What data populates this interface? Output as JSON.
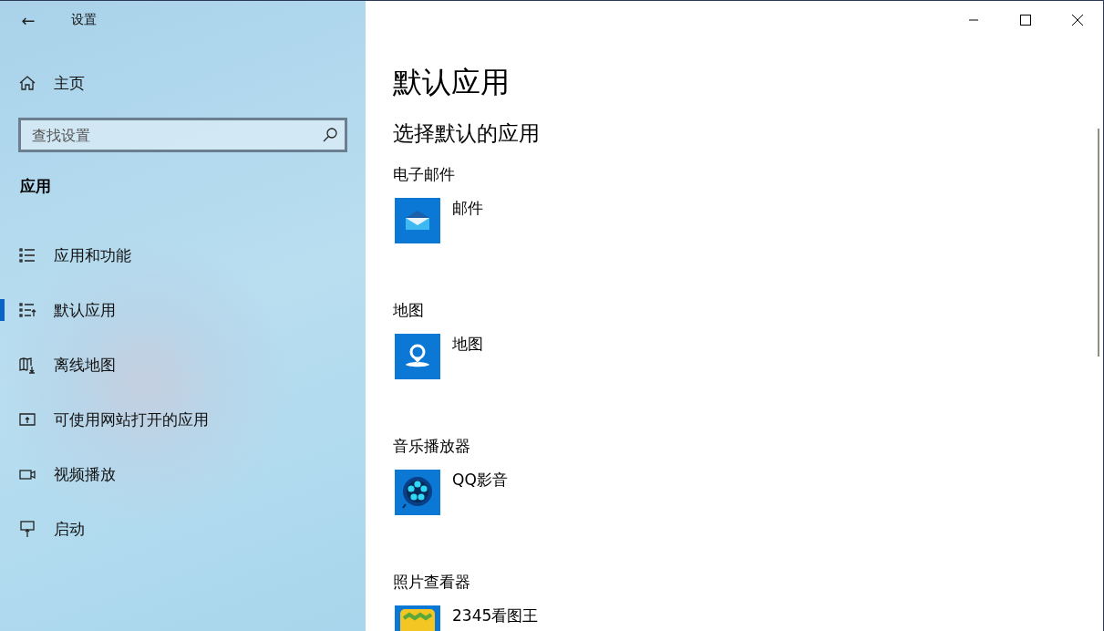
{
  "window": {
    "title": "设置",
    "back": "←"
  },
  "sidebar": {
    "home": "主页",
    "search": {
      "placeholder": "查找设置"
    },
    "section": "应用",
    "items": [
      {
        "label": "应用和功能",
        "kind": "list",
        "selected": false
      },
      {
        "label": "默认应用",
        "kind": "default",
        "selected": true
      },
      {
        "label": "离线地图",
        "kind": "map",
        "selected": false
      },
      {
        "label": "可使用网站打开的应用",
        "kind": "web",
        "selected": false
      },
      {
        "label": "视频播放",
        "kind": "video",
        "selected": false
      },
      {
        "label": "启动",
        "kind": "startup",
        "selected": false
      }
    ]
  },
  "main": {
    "title": "默认应用",
    "subtitle": "选择默认的应用",
    "defaults": [
      {
        "category": "电子邮件",
        "app": "邮件",
        "kind": "mail"
      },
      {
        "category": "地图",
        "app": "地图",
        "kind": "maps"
      },
      {
        "category": "音乐播放器",
        "app": "QQ影音",
        "kind": "player"
      },
      {
        "category": "照片查看器",
        "app": "2345看图王",
        "kind": "viewer"
      }
    ]
  }
}
